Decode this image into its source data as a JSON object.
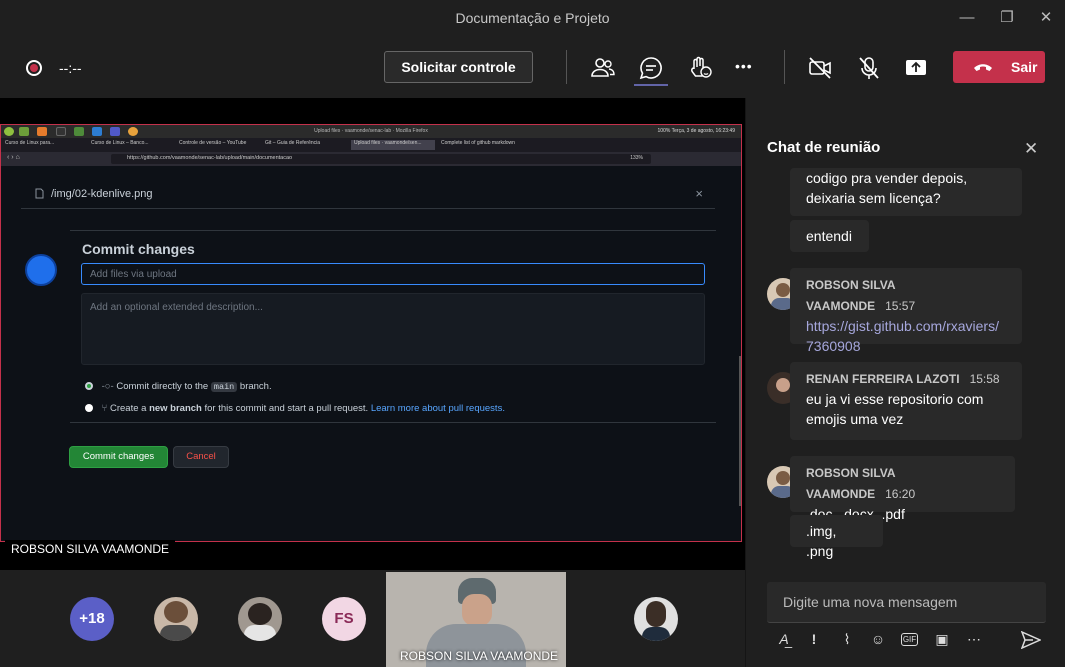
{
  "window": {
    "title": "Documentação e Projeto",
    "minimize": "—",
    "restore": "❐",
    "close": "✕"
  },
  "toolbar": {
    "timer": "--:--",
    "request_control": "Solicitar controle",
    "more": "•••",
    "leave": "Sair"
  },
  "share": {
    "presenter_name": "ROBSON SILVA VAAMONDE",
    "browser_title": "Upload files · vaamonde/senac-lab · Mozilla Firefox",
    "clock": "100%  Terça, 3 de agosto, 16:23:49",
    "tabs": [
      "Curso de Linux para...",
      "Curso de Linux – Banco...",
      "Controle de versão – YouTube",
      "Git – Guia de Referência",
      "Upload files · vaamonde/sen...",
      "Complete list of github markdown"
    ],
    "url": "https://github.com/vaamonde/senac-lab/upload/main/documentacao",
    "zoom": "133%",
    "file_name": "/img/02-kdenlive.png",
    "remove_file": "×",
    "commit_title": "Commit changes",
    "commit_placeholder": "Add files via upload",
    "desc_placeholder": "Add an optional extended description...",
    "radio1_pre": "Commit directly to the",
    "radio1_branch": "main",
    "radio1_post": "branch.",
    "radio2_pre": "Create a",
    "radio2_bold": "new branch",
    "radio2_mid": "for this commit and start a pull request.",
    "radio2_link": "Learn more about pull requests.",
    "commit_button": "Commit changes",
    "cancel_button": "Cancel"
  },
  "chat": {
    "title": "Chat de reunião",
    "close": "✕",
    "messages": [
      {
        "text": "codigo pra vender depois, deixaria sem licença?"
      },
      {
        "text": "entendi"
      },
      {
        "author": "ROBSON SILVA VAAMONDE",
        "time": "15:57",
        "link": "https://gist.github.com/rxaviers/7360908"
      },
      {
        "author": "RENAN FERREIRA LAZOTI",
        "time": "15:58",
        "text": "eu ja vi esse repositorio com emojis uma vez"
      },
      {
        "author": "ROBSON SILVA VAAMONDE",
        "time": "16:20",
        "text": ".doc, .docx, .pdf"
      },
      {
        "text": ".img, .png"
      }
    ],
    "compose_placeholder": "Digite uma nova mensagem",
    "gif_label": "GIF"
  },
  "participants": {
    "overflow": "+18",
    "initials": "FS",
    "video_name": "ROBSON SILVA VAAMONDE"
  },
  "colors": {
    "accent": "#6264a7",
    "leave": "#c4314b",
    "github_green": "#238636",
    "github_blue": "#388bfd"
  }
}
